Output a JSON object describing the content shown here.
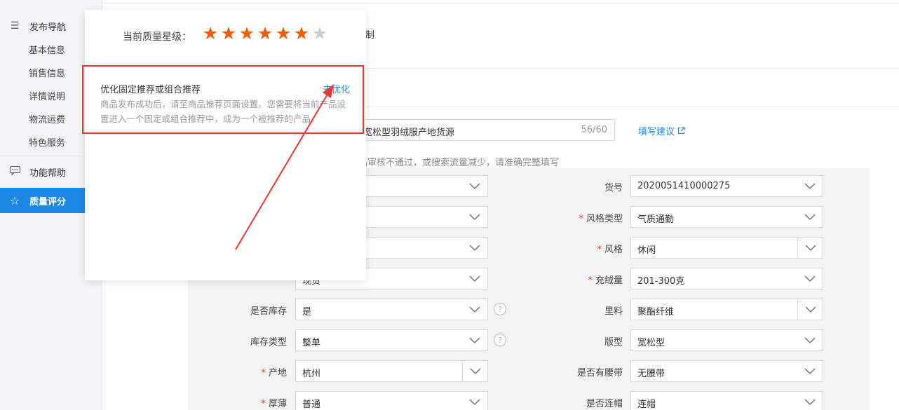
{
  "sidebar": {
    "publish_nav": "发布导航",
    "items": [
      "基本信息",
      "销售信息",
      "详情说明",
      "物流运费",
      "特色服务"
    ],
    "help": "功能帮助",
    "quality": "质量评分"
  },
  "main": {
    "top_fragment": "制",
    "title_value": "宽松型羽绒服产地货源",
    "title_count": "56/60",
    "suggest_link": "填写建议",
    "warning_fragment": "品审核不通过，或搜索流量减少，请准确完整填写"
  },
  "form": {
    "left": [
      {
        "label": "",
        "value": ""
      },
      {
        "label": "",
        "value": ""
      },
      {
        "label": "",
        "value": ""
      },
      {
        "label": "",
        "value": "现货"
      },
      {
        "label": "是否库存",
        "value": "是"
      },
      {
        "label": "库存类型",
        "value": "整单"
      },
      {
        "label": "产地",
        "value": "杭州"
      },
      {
        "label": "厚薄",
        "value": "普通"
      }
    ],
    "right": [
      {
        "label": "货号",
        "value": "2020051410000275"
      },
      {
        "label": "风格类型",
        "value": "气质通勤"
      },
      {
        "label": "风格",
        "value": "休闲"
      },
      {
        "label": "充绒量",
        "value": "201-300克"
      },
      {
        "label": "里料",
        "value": "聚酯纤维"
      },
      {
        "label": "版型",
        "value": "宽松型"
      },
      {
        "label": "是否有腰带",
        "value": "无腰带"
      },
      {
        "label": "是否连帽",
        "value": "连帽"
      }
    ]
  },
  "popup": {
    "star_label": "当前质量星级：",
    "stars_filled": 6,
    "stars_total": 7,
    "star_color": "#ff5a00",
    "star_empty_color": "#cccccc",
    "rec_title": "优化固定推荐或组合推荐",
    "rec_link": "去优化",
    "rec_desc": "商品发布成功后，请至商品推荐页面设置。您需要将当前产品设置进入一个固定或组合推荐中，成为一个被推荐的产品。"
  },
  "colors": {
    "accent": "#1e88e5",
    "annotation": "#e53935"
  }
}
